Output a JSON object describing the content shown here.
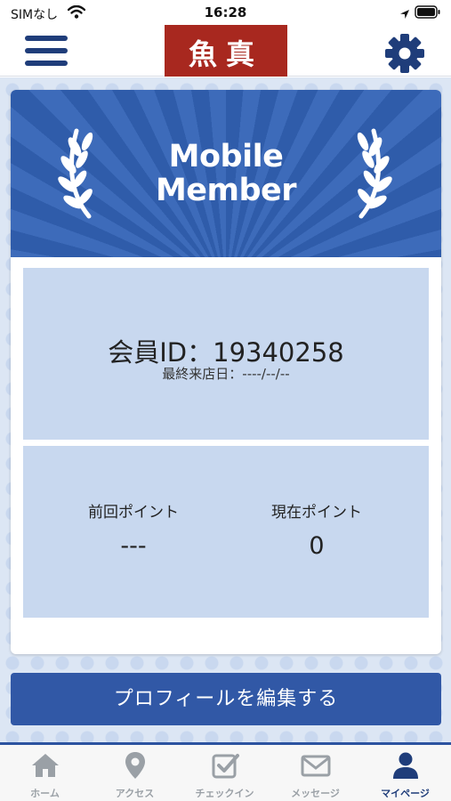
{
  "status_bar": {
    "carrier": "SIMなし",
    "time": "16:28"
  },
  "header": {
    "logo_text": "魚真"
  },
  "banner": {
    "line1": "Mobile",
    "line2": "Member"
  },
  "member": {
    "id_line": "会員ID：19340258",
    "last_visit": "最終来店日：----/--/--"
  },
  "points": {
    "previous_label": "前回ポイント",
    "previous_value": "---",
    "current_label": "現在ポイント",
    "current_value": "0"
  },
  "edit_profile_label": "プロフィールを編集する",
  "tabs": [
    {
      "label": "ホーム",
      "icon": "home-icon",
      "active": false
    },
    {
      "label": "アクセス",
      "icon": "map-pin-icon",
      "active": false
    },
    {
      "label": "チェックイン",
      "icon": "checkbox-icon",
      "active": false
    },
    {
      "label": "メッセージ",
      "icon": "envelope-icon",
      "active": false
    },
    {
      "label": "マイページ",
      "icon": "person-icon",
      "active": true
    }
  ],
  "colors": {
    "accent": "#2c53a0",
    "nav_icon": "#1f3d7a",
    "logo_bg": "#a8281f",
    "panel_bg": "#c8d8ef",
    "tab_inactive": "#9aa0a6"
  }
}
